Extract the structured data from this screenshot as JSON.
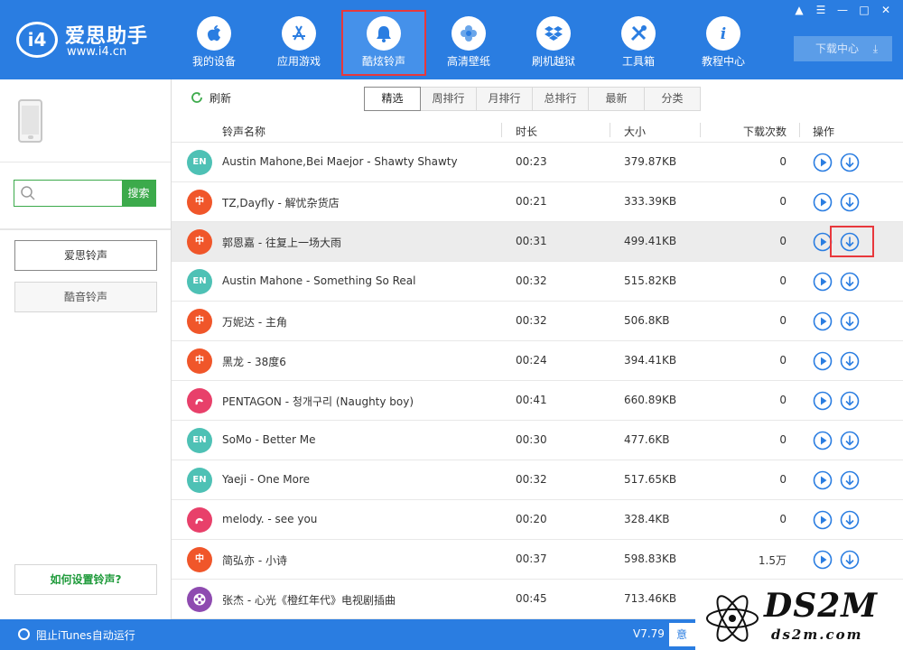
{
  "app": {
    "logo_mark": "i4",
    "name": "爱思助手",
    "url": "www.i4.cn"
  },
  "nav": [
    {
      "label": "我的设备",
      "icon": "apple-icon"
    },
    {
      "label": "应用游戏",
      "icon": "app-store-icon"
    },
    {
      "label": "酷炫铃声",
      "icon": "bell-icon",
      "active": true
    },
    {
      "label": "高清壁纸",
      "icon": "flower-icon"
    },
    {
      "label": "刷机越狱",
      "icon": "dropbox-icon"
    },
    {
      "label": "工具箱",
      "icon": "tools-icon"
    },
    {
      "label": "教程中心",
      "icon": "info-icon"
    }
  ],
  "window_controls": [
    "shirt-icon",
    "menu-icon",
    "minimize-icon",
    "maximize-icon",
    "close-icon"
  ],
  "download_center": {
    "label": "下载中心",
    "icon": "download-tray-icon"
  },
  "sidebar": {
    "search_placeholder": "",
    "search_button": "搜索",
    "buttons": [
      "爱思铃声",
      "酷音铃声"
    ],
    "help_link": "如何设置铃声?"
  },
  "toolbar": {
    "refresh_label": "刷新",
    "tabs": [
      "精选",
      "周排行",
      "月排行",
      "总排行",
      "最新",
      "分类"
    ],
    "active_tab": "精选"
  },
  "table": {
    "columns": {
      "name": "铃声名称",
      "duration": "时长",
      "size": "大小",
      "downloads": "下载次数",
      "actions": "操作"
    },
    "rows": [
      {
        "badge": "EN",
        "badge_color": "#4ec1b5",
        "title": "Austin Mahone,Bei Maejor - Shawty Shawty",
        "duration": "00:23",
        "size": "379.87KB",
        "downloads": "0"
      },
      {
        "badge": "中",
        "badge_color": "#f0562a",
        "title": "TZ,Dayfly - 解忧杂货店",
        "duration": "00:21",
        "size": "333.39KB",
        "downloads": "0"
      },
      {
        "badge": "中",
        "badge_color": "#f0562a",
        "title": "郭恩嘉 - 往复上一场大雨",
        "duration": "00:31",
        "size": "499.41KB",
        "downloads": "0",
        "highlighted": true
      },
      {
        "badge": "EN",
        "badge_color": "#4ec1b5",
        "title": "Austin Mahone - Something So Real",
        "duration": "00:32",
        "size": "515.82KB",
        "downloads": "0"
      },
      {
        "badge": "中",
        "badge_color": "#f0562a",
        "title": "万妮达 - 主角",
        "duration": "00:32",
        "size": "506.8KB",
        "downloads": "0"
      },
      {
        "badge": "中",
        "badge_color": "#f0562a",
        "title": "黑龙 - 38度6",
        "duration": "00:24",
        "size": "394.41KB",
        "downloads": "0"
      },
      {
        "badge": "",
        "badge_color": "#e8406a",
        "title": "PENTAGON - 청개구리 (Naughty boy)",
        "duration": "00:41",
        "size": "660.89KB",
        "downloads": "0"
      },
      {
        "badge": "EN",
        "badge_color": "#4ec1b5",
        "title": "SoMo - Better Me",
        "duration": "00:30",
        "size": "477.6KB",
        "downloads": "0"
      },
      {
        "badge": "EN",
        "badge_color": "#4ec1b5",
        "title": "Yaeji - One More",
        "duration": "00:32",
        "size": "517.65KB",
        "downloads": "0"
      },
      {
        "badge": "",
        "badge_color": "#e8406a",
        "title": "melody. - see you",
        "duration": "00:20",
        "size": "328.4KB",
        "downloads": "0"
      },
      {
        "badge": "中",
        "badge_color": "#f0562a",
        "title": "简弘亦 - 小诗",
        "duration": "00:37",
        "size": "598.83KB",
        "downloads": "1.5万"
      },
      {
        "badge": "",
        "badge_color": "#8e4bb0",
        "title": "张杰 - 心光《橙红年代》电视剧插曲",
        "duration": "00:45",
        "size": "713.46KB",
        "downloads": ""
      }
    ]
  },
  "footer": {
    "itunes_toggle": "阻止iTunes自动运行",
    "version": "V7.79",
    "feedback": "意"
  },
  "watermark": {
    "text": "DS2M",
    "url": "ds2m.com"
  },
  "colors": {
    "header_blue": "#2a7de1",
    "accent_green": "#3caa4b",
    "highlight_red": "#e8383c"
  }
}
